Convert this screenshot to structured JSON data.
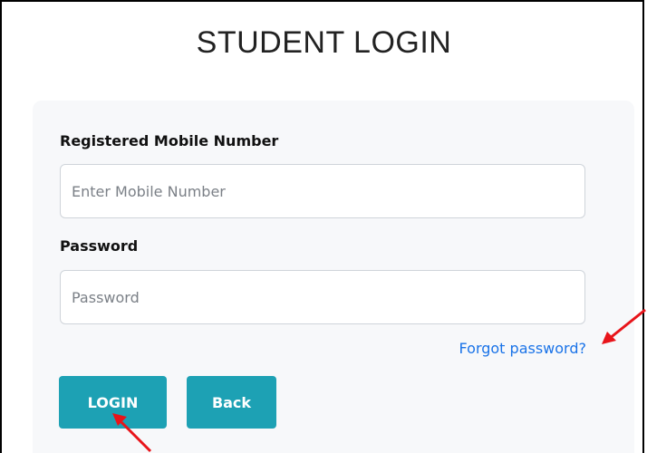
{
  "page": {
    "title": "STUDENT LOGIN"
  },
  "form": {
    "mobile_label": "Registered Mobile Number",
    "mobile_placeholder": "Enter Mobile Number",
    "mobile_value": "",
    "password_label": "Password",
    "password_placeholder": "Password",
    "password_value": "",
    "forgot_link": "Forgot password?",
    "login_button": "LOGIN",
    "back_button": "Back"
  },
  "colors": {
    "button": "#1da1b4",
    "link": "#1a73e8",
    "card_background": "#f7f8fa",
    "annotation_arrow": "#e8141a"
  },
  "annotations": [
    {
      "icon": "red-arrow-icon",
      "points_to": "forgot-password-link"
    },
    {
      "icon": "red-arrow-icon",
      "points_to": "login-button"
    }
  ]
}
